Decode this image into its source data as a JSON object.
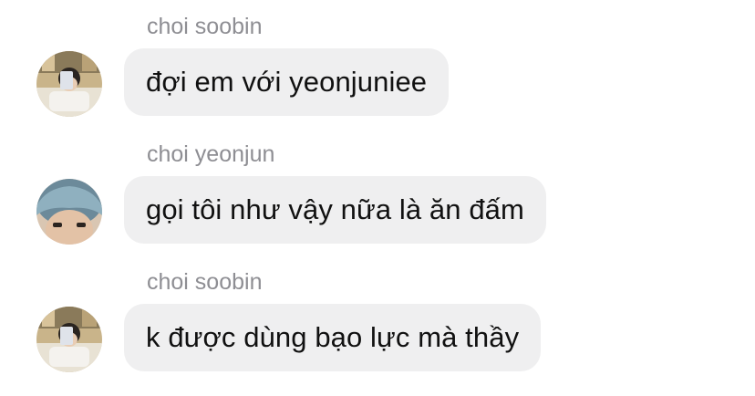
{
  "messages": [
    {
      "sender": "choi soobin",
      "text": "đợi em với yeonjuniee",
      "avatar_icon": "user-photo-soobin-icon"
    },
    {
      "sender": "choi yeonjun",
      "text": "gọi tôi như vậy nữa là ăn đấm",
      "avatar_icon": "user-photo-yeonjun-icon"
    },
    {
      "sender": "choi soobin",
      "text": "k được dùng bạo lực mà thầy",
      "avatar_icon": "user-photo-soobin-icon"
    }
  ],
  "colors": {
    "bubble_background": "#efeff0",
    "sender_name": "#8e8e93",
    "message_text": "#111111",
    "page_background": "#ffffff"
  }
}
